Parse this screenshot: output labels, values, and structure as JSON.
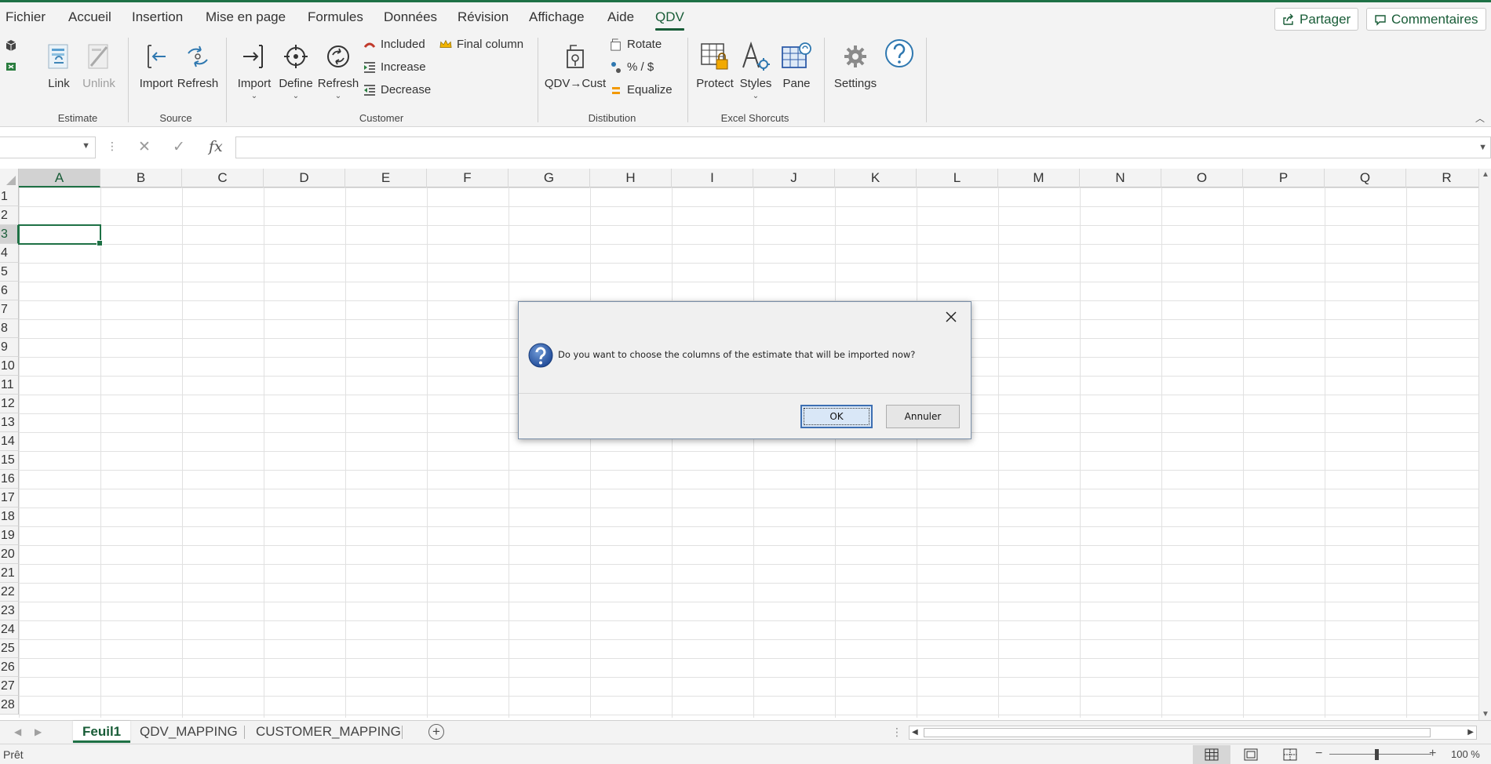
{
  "menu": {
    "tabs": [
      "Fichier",
      "Accueil",
      "Insertion",
      "Mise en page",
      "Formules",
      "Données",
      "Révision",
      "Affichage",
      "Aide",
      "QDV"
    ],
    "active_tab": "QDV",
    "share_label": "Partager",
    "comments_label": "Commentaires"
  },
  "ribbon": {
    "estimate": {
      "group": "Estimate",
      "link": "Link",
      "unlink": "Unlink"
    },
    "source": {
      "group": "Source",
      "import": "Import",
      "refresh": "Refresh"
    },
    "customer": {
      "group": "Customer",
      "import": "Import",
      "define": "Define",
      "refresh": "Refresh",
      "included": "Included",
      "increase": "Increase",
      "decrease": "Decrease",
      "final_column": "Final column"
    },
    "distribution": {
      "group": "Distibution",
      "qdv_cust": "QDV→Cust",
      "rotate": "Rotate",
      "percent": "% / $",
      "equalize": "Equalize"
    },
    "shortcuts": {
      "group": "Excel Shorcuts",
      "protect": "Protect",
      "styles": "Styles",
      "pane": "Pane"
    },
    "settings": {
      "settings": "Settings"
    }
  },
  "formula_bar": {
    "name_box": "",
    "formula": ""
  },
  "grid": {
    "columns": [
      "A",
      "B",
      "C",
      "D",
      "E",
      "F",
      "G",
      "H",
      "I",
      "J",
      "K",
      "L",
      "M",
      "N",
      "O",
      "P",
      "Q",
      "R"
    ],
    "rows": [
      "1",
      "2",
      "3",
      "4",
      "5",
      "6",
      "7",
      "8",
      "9",
      "10",
      "11",
      "12",
      "13",
      "14",
      "15",
      "16",
      "17",
      "18",
      "19",
      "20",
      "21",
      "22",
      "23",
      "24",
      "25",
      "26",
      "27",
      "28"
    ],
    "selected_column": "A",
    "selected_row": "3"
  },
  "sheets": {
    "tabs": [
      "Feuil1",
      "QDV_MAPPING",
      "CUSTOMER_MAPPING"
    ],
    "active": "Feuil1"
  },
  "status": {
    "text": "Prêt",
    "zoom": "100 %"
  },
  "dialog": {
    "message": "Do you want to choose the columns of the estimate that will be imported now?",
    "ok_label": "OK",
    "cancel_label": "Annuler"
  },
  "colors": {
    "accent": "#185c37",
    "selection": "#1e7145",
    "dialog_bg": "#f0f0f0",
    "dialog_primary_border": "#3d6fb2"
  }
}
